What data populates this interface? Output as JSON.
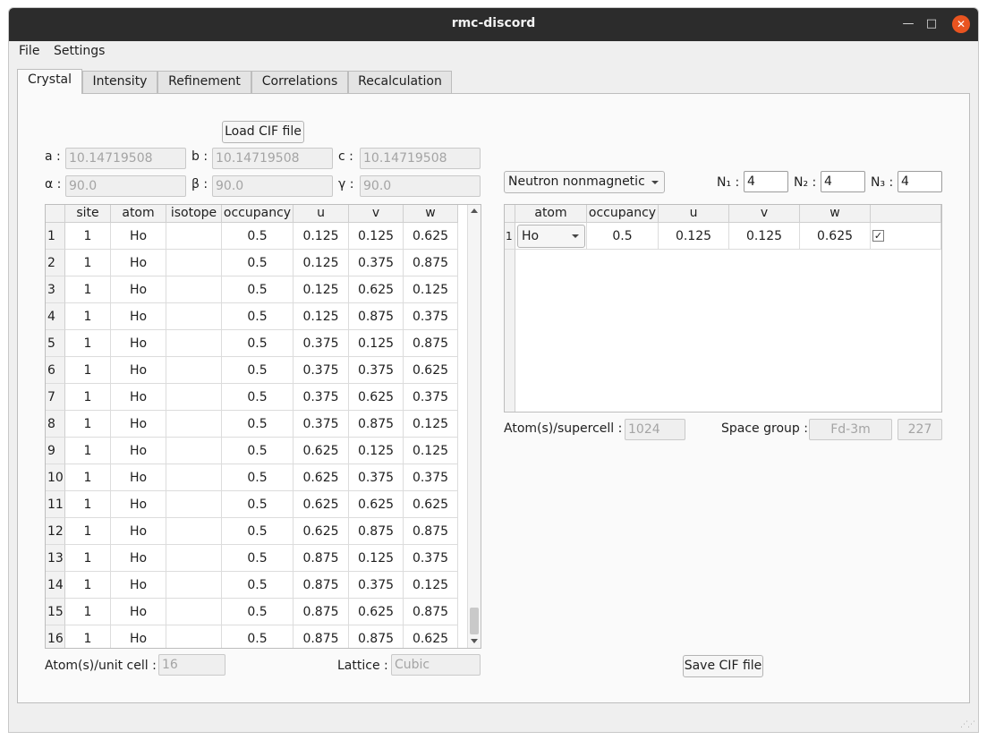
{
  "window": {
    "title": "rmc-discord"
  },
  "menu": {
    "file": "File",
    "settings": "Settings"
  },
  "tabs": [
    "Crystal",
    "Intensity",
    "Refinement",
    "Correlations",
    "Recalculation"
  ],
  "crystal": {
    "load_cif": "Load CIF file",
    "a_label": "a :",
    "b_label": "b :",
    "c_label": "c :",
    "alpha_label": "α :",
    "beta_label": "β :",
    "gamma_label": "γ :",
    "a": "10.14719508",
    "b": "10.14719508",
    "c": "10.14719508",
    "alpha": "90.0",
    "beta": "90.0",
    "gamma": "90.0",
    "atoms_unit_cell_label": "Atom(s)/unit cell :",
    "atoms_unit_cell": "16",
    "lattice_label": "Lattice :",
    "lattice": "Cubic"
  },
  "atom_table": {
    "headers": [
      "site",
      "atom",
      "isotope",
      "occupancy",
      "u",
      "v",
      "w"
    ],
    "rows": [
      [
        "1",
        "1",
        "Ho",
        "",
        "0.5",
        "0.125",
        "0.125",
        "0.625"
      ],
      [
        "2",
        "1",
        "Ho",
        "",
        "0.5",
        "0.125",
        "0.375",
        "0.875"
      ],
      [
        "3",
        "1",
        "Ho",
        "",
        "0.5",
        "0.125",
        "0.625",
        "0.125"
      ],
      [
        "4",
        "1",
        "Ho",
        "",
        "0.5",
        "0.125",
        "0.875",
        "0.375"
      ],
      [
        "5",
        "1",
        "Ho",
        "",
        "0.5",
        "0.375",
        "0.125",
        "0.875"
      ],
      [
        "6",
        "1",
        "Ho",
        "",
        "0.5",
        "0.375",
        "0.375",
        "0.625"
      ],
      [
        "7",
        "1",
        "Ho",
        "",
        "0.5",
        "0.375",
        "0.625",
        "0.375"
      ],
      [
        "8",
        "1",
        "Ho",
        "",
        "0.5",
        "0.375",
        "0.875",
        "0.125"
      ],
      [
        "9",
        "1",
        "Ho",
        "",
        "0.5",
        "0.625",
        "0.125",
        "0.125"
      ],
      [
        "10",
        "1",
        "Ho",
        "",
        "0.5",
        "0.625",
        "0.375",
        "0.375"
      ],
      [
        "11",
        "1",
        "Ho",
        "",
        "0.5",
        "0.625",
        "0.625",
        "0.625"
      ],
      [
        "12",
        "1",
        "Ho",
        "",
        "0.5",
        "0.625",
        "0.875",
        "0.875"
      ],
      [
        "13",
        "1",
        "Ho",
        "",
        "0.5",
        "0.875",
        "0.125",
        "0.375"
      ],
      [
        "14",
        "1",
        "Ho",
        "",
        "0.5",
        "0.875",
        "0.375",
        "0.125"
      ],
      [
        "15",
        "1",
        "Ho",
        "",
        "0.5",
        "0.875",
        "0.625",
        "0.875"
      ],
      [
        "16",
        "1",
        "Ho",
        "",
        "0.5",
        "0.875",
        "0.875",
        "0.625"
      ]
    ]
  },
  "supercell": {
    "type": "Neutron nonmagnetic",
    "n1_label": "N₁ :",
    "n2_label": "N₂ :",
    "n3_label": "N₃ :",
    "n1": "4",
    "n2": "4",
    "n3": "4",
    "headers": [
      "atom",
      "occupancy",
      "u",
      "v",
      "w",
      ""
    ],
    "rows": [
      {
        "index": "1",
        "atom": "Ho",
        "occupancy": "0.5",
        "u": "0.125",
        "v": "0.125",
        "w": "0.625",
        "checked": true
      }
    ],
    "atoms_supercell_label": "Atom(s)/supercell :",
    "atoms_supercell": "1024",
    "space_group_label": "Space group :",
    "space_group": "Fd-3m",
    "space_group_number": "227",
    "save_cif": "Save CIF file"
  }
}
